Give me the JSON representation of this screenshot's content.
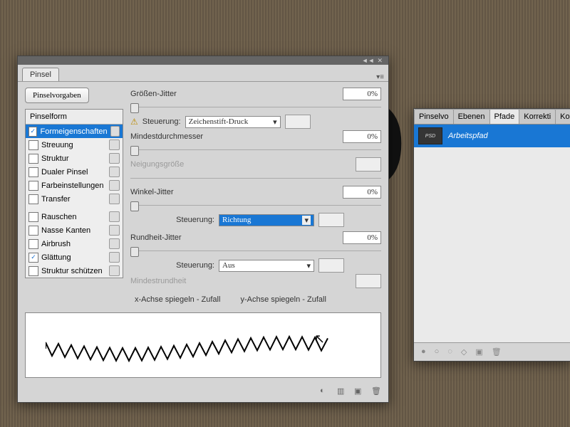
{
  "background_letter": "D",
  "panel": {
    "tab": "Pinsel",
    "presets_btn": "Pinselvorgaben",
    "list_header": "Pinselform",
    "items": [
      {
        "label": "Formeigenschaften",
        "checked": true,
        "selected": true,
        "lock": true
      },
      {
        "label": "Streuung",
        "checked": false,
        "lock": true
      },
      {
        "label": "Struktur",
        "checked": false,
        "lock": true
      },
      {
        "label": "Dualer Pinsel",
        "checked": false,
        "lock": true
      },
      {
        "label": "Farbeinstellungen",
        "checked": false,
        "lock": true
      },
      {
        "label": "Transfer",
        "checked": false,
        "lock": true
      }
    ],
    "items2": [
      {
        "label": "Rauschen",
        "checked": false,
        "lock": true
      },
      {
        "label": "Nasse Kanten",
        "checked": false,
        "lock": true
      },
      {
        "label": "Airbrush",
        "checked": false,
        "lock": true
      },
      {
        "label": "Glättung",
        "checked": true,
        "lock": true
      },
      {
        "label": "Struktur schützen",
        "checked": false,
        "lock": true
      }
    ],
    "controls": {
      "size_jitter": {
        "label": "Größen-Jitter",
        "value": "0%"
      },
      "control1": {
        "label": "Steuerung:",
        "value": "Zeichenstift-Druck"
      },
      "min_diam": {
        "label": "Mindestdurchmesser",
        "value": "0%"
      },
      "tilt_scale": "Neigungsgröße",
      "angle_jitter": {
        "label": "Winkel-Jitter",
        "value": "0%"
      },
      "control2": {
        "label": "Steuerung:",
        "value": "Richtung"
      },
      "round_jitter": {
        "label": "Rundheit-Jitter",
        "value": "0%"
      },
      "control3": {
        "label": "Steuerung:",
        "value": "Aus"
      },
      "min_round": "Mindestrundheit",
      "flipx": "x-Achse spiegeln - Zufall",
      "flipy": "y-Achse spiegeln - Zufall"
    }
  },
  "rpanel": {
    "tabs": [
      "Pinselvo",
      "Ebenen",
      "Pfade",
      "Korrekti",
      "Kopiero"
    ],
    "active_tab": 2,
    "item": "Arbeitspfad",
    "thumb_text": "PSD"
  }
}
